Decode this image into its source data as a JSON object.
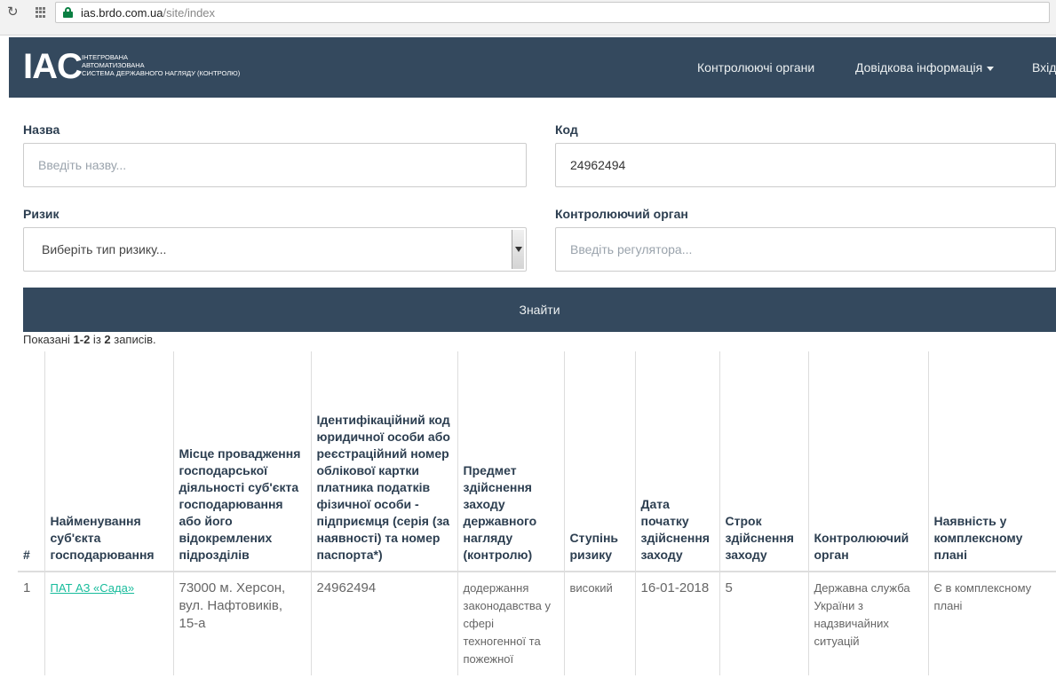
{
  "browser": {
    "url_host": "ias.brdo.com.ua",
    "url_path": "/site/index"
  },
  "navbar": {
    "logo": "IAC",
    "logo_lines": [
      "Інтегрована",
      "автоматизована",
      "система державного нагляду (контролю)"
    ],
    "links": [
      "Контролюючі органи",
      "Довідкова інформація",
      "Вхід"
    ]
  },
  "form": {
    "name_label": "Назва",
    "name_placeholder": "Введіть назву...",
    "code_label": "Код",
    "code_value": "24962494",
    "risk_label": "Ризик",
    "risk_selected": "Виберіть тип ризику...",
    "regulator_label": "Контролюючий орган",
    "regulator_placeholder": "Введіть регулятора...",
    "search_button": "Знайти"
  },
  "summary": {
    "prefix": "Показані ",
    "range": "1-2",
    "middle": " із ",
    "total": "2",
    "suffix": " записів."
  },
  "table": {
    "headers": [
      "#",
      "Найменування суб'єкта господарювання",
      "Місце провадження господарської діяльності суб'єкта господарювання або його відокремлених підрозділів",
      "Ідентифікаційний код юридичної особи або реєстраційний номер облікової картки платника податків фізичної особи - підприємця (серія (за наявності) та номер паспорта*)",
      "Предмет здійснення заходу державного нагляду (контролю)",
      "Ступінь ризику",
      "Дата початку здійснення заходу",
      "Строк здійснення заходу",
      "Контролюючий орган",
      "Наявність у комплексному плані"
    ],
    "rows": [
      {
        "num": "1",
        "name": "ПАТ АЗ «Сада»",
        "place": "73000 м. Херсон, вул. Нафтовиків, 15-а",
        "code": "24962494",
        "subject": "додержання законодавства у сфері техногенної та пожежної",
        "risk": "високий",
        "date": "16-01-2018",
        "term": "5",
        "authority": "Державна служба України з надзвичайних ситуацій",
        "plan": "Є в комплексному плані"
      }
    ]
  },
  "colors": {
    "navbar": "#34495e",
    "link": "#18bc9c"
  }
}
